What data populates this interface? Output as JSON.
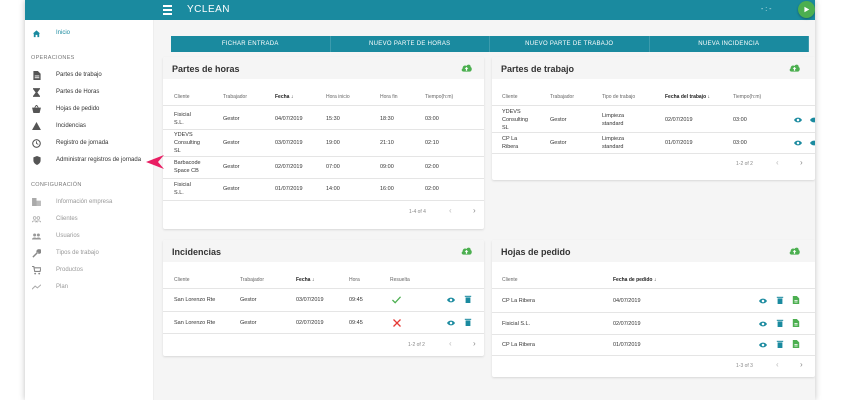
{
  "app": {
    "title": "YCLEAN",
    "user_text": "- : -"
  },
  "colors": {
    "primary": "#1a8a9f",
    "accent": "#4caf50",
    "danger": "#e53935"
  },
  "sidebar": {
    "items": [
      {
        "label": "Inicio",
        "icon": "home-icon"
      }
    ],
    "operaciones_title": "OPERACIONES",
    "operaciones": [
      {
        "label": "Partes de trabajo",
        "icon": "document-icon"
      },
      {
        "label": "Partes de Horas",
        "icon": "hourglass-icon"
      },
      {
        "label": "Hojas de pedido",
        "icon": "basket-icon"
      },
      {
        "label": "Incidencias",
        "icon": "warning-icon"
      },
      {
        "label": "Registro de jornada",
        "icon": "clock-icon"
      },
      {
        "label": "Administrar registros de jornada",
        "icon": "shield-icon"
      }
    ],
    "config_title": "CONFIGURACIÓN",
    "configuracion": [
      {
        "label": "Información empresa",
        "icon": "building-icon"
      },
      {
        "label": "Clientes",
        "icon": "people-icon"
      },
      {
        "label": "Usuarios",
        "icon": "group-icon"
      },
      {
        "label": "Tipos de trabajo",
        "icon": "wrench-icon"
      },
      {
        "label": "Productos",
        "icon": "cart-icon"
      },
      {
        "label": "Plan",
        "icon": "trend-icon"
      }
    ]
  },
  "actions": [
    "FICHAR ENTRADA",
    "NUEVO PARTE DE HORAS",
    "NUEVO PARTE DE TRABAJO",
    "NUEVA INCIDENCIA"
  ],
  "partes_horas": {
    "title": "Partes de horas",
    "headers": [
      "Cliente",
      "Trabajador",
      "Fecha",
      "Hora inicio",
      "Hora fin",
      "Tiempo(h:m)"
    ],
    "rows": [
      {
        "cliente": "Fisicial\nS.L.",
        "trabajador": "Gestor",
        "fecha": "04/07/2019",
        "inicio": "15:30",
        "fin": "18:30",
        "tiempo": "03:00"
      },
      {
        "cliente": "YDEVS\nConsulting\nSL",
        "trabajador": "Gestor",
        "fecha": "03/07/2019",
        "inicio": "19:00",
        "fin": "21:10",
        "tiempo": "02:10"
      },
      {
        "cliente": "Barbacode\nSpace CB",
        "trabajador": "Gestor",
        "fecha": "02/07/2019",
        "inicio": "07:00",
        "fin": "09:00",
        "tiempo": "02:00"
      },
      {
        "cliente": "Fisicial\nS.L.",
        "trabajador": "Gestor",
        "fecha": "01/07/2019",
        "inicio": "14:00",
        "fin": "16:00",
        "tiempo": "02:00"
      }
    ],
    "pagination": "1-4 of 4"
  },
  "partes_trabajo": {
    "title": "Partes de trabajo",
    "headers": [
      "Cliente",
      "Trabajador",
      "Tipo de trabajo",
      "Fecha del trabajo",
      "Tiempo(h:m)"
    ],
    "rows": [
      {
        "cliente": "YDEVS\nConsulting\nSL",
        "trabajador": "Gestor",
        "tipo": "Limpieza\nstandard",
        "fecha": "02/07/2019",
        "tiempo": "03:00"
      },
      {
        "cliente": "CP La\nRibera",
        "trabajador": "Gestor",
        "tipo": "Limpieza\nstandard",
        "fecha": "01/07/2019",
        "tiempo": "03:00"
      }
    ],
    "pagination": "1-2 of 2"
  },
  "incidencias": {
    "title": "Incidencias",
    "headers": [
      "Cliente",
      "Trabajador",
      "Fecha",
      "Hora",
      "Resuelta"
    ],
    "rows": [
      {
        "cliente": "San Lorenzo Rte",
        "trabajador": "Gestor",
        "fecha": "03/07/2019",
        "hora": "09:45",
        "resuelta": true
      },
      {
        "cliente": "San Lorenzo Rte",
        "trabajador": "Gestor",
        "fecha": "02/07/2019",
        "hora": "09:45",
        "resuelta": false
      }
    ],
    "pagination": "1-2 of 2"
  },
  "hojas_pedido": {
    "title": "Hojas de pedido",
    "headers": [
      "Cliente",
      "Fecha de pedido"
    ],
    "rows": [
      {
        "cliente": "CP La Ribera",
        "fecha": "04/07/2019"
      },
      {
        "cliente": "Fisicial S.L.",
        "fecha": "02/07/2019"
      },
      {
        "cliente": "CP La Ribera",
        "fecha": "01/07/2019"
      }
    ],
    "pagination": "1-3 of 3"
  },
  "sort_arrow": "↓",
  "nav_prev": "‹",
  "nav_next": "›"
}
